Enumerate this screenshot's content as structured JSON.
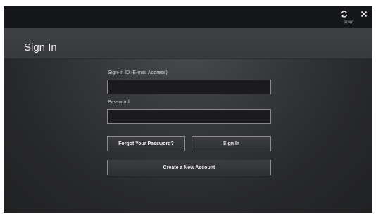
{
  "topbar": {
    "refresh_icon": "refresh-icon",
    "close_icon": "close-icon",
    "brand_label": "SONY"
  },
  "header": {
    "title": "Sign In"
  },
  "form": {
    "signin_id_label": "Sign-In ID (E-mail Address)",
    "signin_id_value": "",
    "password_label": "Password",
    "password_value": ""
  },
  "buttons": {
    "forgot_password": "Forgot Your Password?",
    "sign_in": "Sign In",
    "create_account": "Create a New Account"
  },
  "colors": {
    "background": "#2b2c30",
    "topbar": "#16171a",
    "input_fill": "#1b1a1c",
    "border": "#8a8a8c"
  }
}
